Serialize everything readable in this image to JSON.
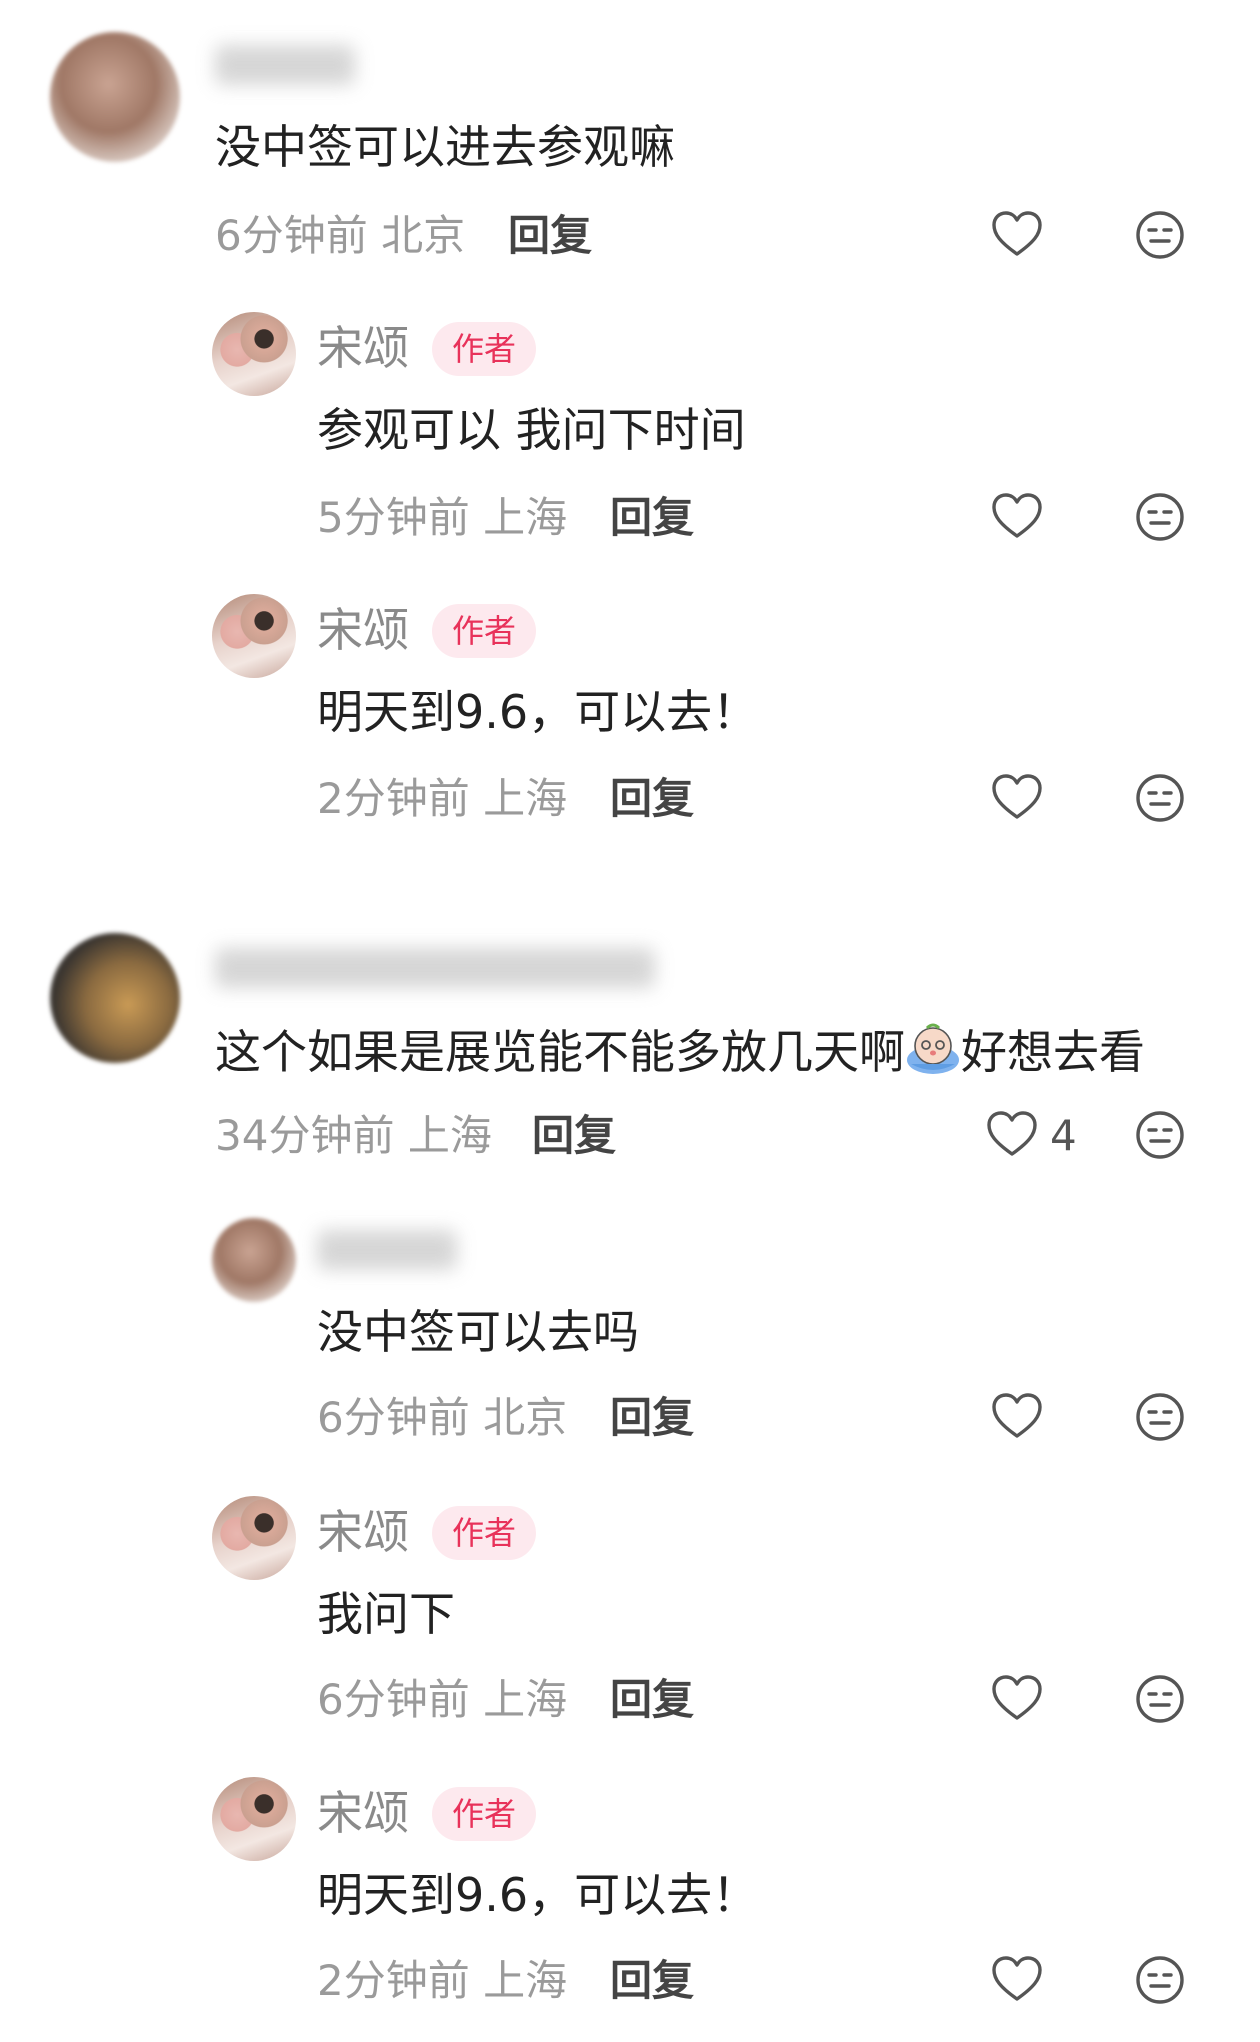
{
  "colors": {
    "text": "#222222",
    "meta": "#9a9a9a",
    "author_badge_text": "#e8325a",
    "author_badge_bg": "#fde9ee",
    "icon_stroke": "#555555"
  },
  "comments": [
    {
      "text": "没中签可以进去参观嘛",
      "time": "6分钟前",
      "location": "北京",
      "reply_label": "回复",
      "replies": [
        {
          "author": "宋颂",
          "badge": "作者",
          "text": "参观可以 我问下时间",
          "time": "5分钟前",
          "location": "上海",
          "reply_label": "回复"
        },
        {
          "author": "宋颂",
          "badge": "作者",
          "text": "明天到9.6，可以去！",
          "time": "2分钟前",
          "location": "上海",
          "reply_label": "回复"
        }
      ]
    },
    {
      "text_before_emoji": "这个如果是展览能不能多放几天啊",
      "emoji": "crying-emoji",
      "text_after_emoji": "好想去看",
      "time": "34分钟前",
      "location": "上海",
      "reply_label": "回复",
      "like_count": "4",
      "replies": [
        {
          "text": "没中签可以去吗",
          "time": "6分钟前",
          "location": "北京",
          "reply_label": "回复"
        },
        {
          "author": "宋颂",
          "badge": "作者",
          "text": "我问下",
          "time": "6分钟前",
          "location": "上海",
          "reply_label": "回复"
        },
        {
          "author": "宋颂",
          "badge": "作者",
          "text": "明天到9.6，可以去！",
          "time": "2分钟前",
          "location": "上海",
          "reply_label": "回复"
        }
      ]
    }
  ]
}
